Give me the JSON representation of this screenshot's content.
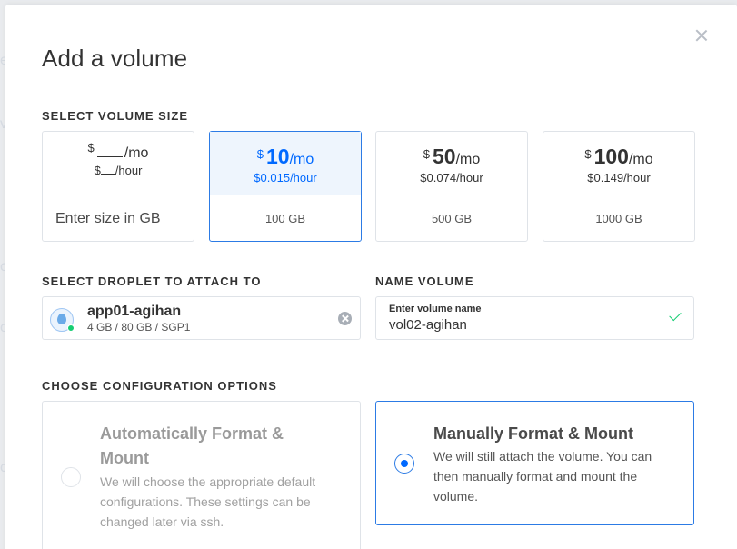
{
  "modal": {
    "title": "Add a volume"
  },
  "size_section": {
    "label": "SELECT VOLUME SIZE",
    "custom": {
      "currency": "$",
      "per_month": "/mo",
      "hour_prefix": "$",
      "per_hour": "/hour",
      "placeholder": "Enter size in GB"
    },
    "options": [
      {
        "currency": "$",
        "amount": "10",
        "per_month": "/mo",
        "hourly": "$0.015",
        "per_hour": "/hour",
        "size": "100 GB",
        "selected": true
      },
      {
        "currency": "$",
        "amount": "50",
        "per_month": "/mo",
        "hourly": "$0.074",
        "per_hour": "/hour",
        "size": "500 GB",
        "selected": false
      },
      {
        "currency": "$",
        "amount": "100",
        "per_month": "/mo",
        "hourly": "$0.149",
        "per_hour": "/hour",
        "size": "1000 GB",
        "selected": false
      }
    ]
  },
  "droplet_section": {
    "label": "SELECT DROPLET TO ATTACH TO",
    "droplet_name": "app01-agihan",
    "droplet_spec": "4 GB / 80 GB / SGP1",
    "status_color": "#15cd72"
  },
  "name_section": {
    "label": "NAME VOLUME",
    "field_label": "Enter volume name",
    "value": "vol02-agihan"
  },
  "config_section": {
    "label": "CHOOSE CONFIGURATION OPTIONS",
    "options": [
      {
        "title": "Automatically Format & Mount",
        "description": "We will choose the appropriate default configurations. These settings can be changed later via ssh.",
        "selected": false,
        "disabled": true
      },
      {
        "title": "Manually Format & Mount",
        "description": "We will still attach the volume. You can then manually format and mount the volume.",
        "selected": true,
        "disabled": false
      }
    ]
  },
  "colors": {
    "accent": "#0069ff",
    "selected_border": "#2c7be5",
    "selected_bg": "#eef5fd",
    "success": "#15cd72"
  }
}
